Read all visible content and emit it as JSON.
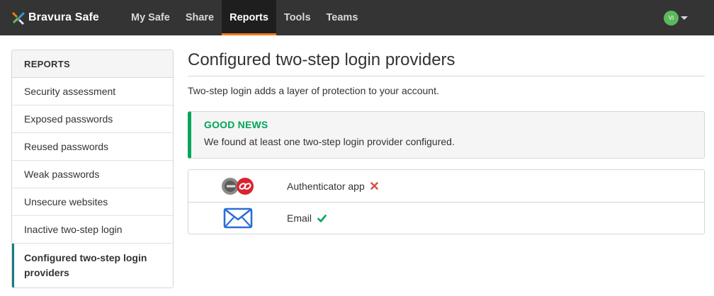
{
  "header": {
    "brand": "Bravura Safe",
    "nav": [
      {
        "label": "My Safe"
      },
      {
        "label": "Share"
      },
      {
        "label": "Reports"
      },
      {
        "label": "Tools"
      },
      {
        "label": "Teams"
      }
    ],
    "user_initials": "VI"
  },
  "sidebar": {
    "title": "REPORTS",
    "items": [
      {
        "label": "Security assessment"
      },
      {
        "label": "Exposed passwords"
      },
      {
        "label": "Reused passwords"
      },
      {
        "label": "Weak passwords"
      },
      {
        "label": "Unsecure websites"
      },
      {
        "label": "Inactive two-step login"
      },
      {
        "label": "Configured two-step login providers"
      }
    ]
  },
  "main": {
    "title": "Configured two-step login providers",
    "description": "Two-step login adds a layer of protection to your account.",
    "callout": {
      "title": "GOOD NEWS",
      "text": "We found at least one two-step login provider configured."
    },
    "providers": [
      {
        "name": "Authenticator app",
        "icon": "authenticator-app-icon",
        "status": "not-configured"
      },
      {
        "name": "Email",
        "icon": "email-icon",
        "status": "configured"
      }
    ]
  },
  "colors": {
    "navbar": "#343434",
    "nav_active_underline": "#f07d1a",
    "sidebar_active_border": "#187b85",
    "success": "#00a65a",
    "error": "#d9534f",
    "email_icon": "#2b6fd6"
  }
}
